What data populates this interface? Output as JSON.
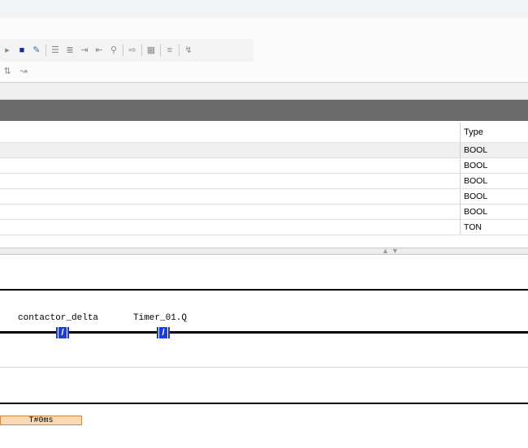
{
  "toolbar": {
    "row1_icons": [
      "run-icon",
      "stop-icon",
      "wrench-icon",
      "insert-row-icon",
      "comment-icon",
      "indent-icon",
      "outdent-icon",
      "monitor-icon",
      "goto-icon",
      "online-icon",
      "filter-icon",
      "edit-icon"
    ],
    "row2_icons": [
      "compare-icon",
      "branch-icon"
    ]
  },
  "variables": {
    "type_header": "Type",
    "rows": [
      {
        "type": "BOOL"
      },
      {
        "type": "BOOL"
      },
      {
        "type": "BOOL"
      },
      {
        "type": "BOOL"
      },
      {
        "type": "BOOL"
      },
      {
        "type": "TON"
      }
    ]
  },
  "ladder": {
    "contact1_var": "contactor_delta",
    "contact2_var": "Timer_01.Q",
    "contact_symbol": "/",
    "time_value": "T#0ms"
  },
  "colors": {
    "contact_blue": "#1f3ed0",
    "dark_header": "#6b6b6b",
    "time_box": "#fbd9b4"
  }
}
